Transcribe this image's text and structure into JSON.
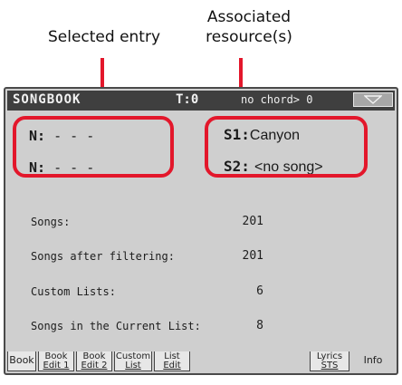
{
  "callouts": {
    "selected": "Selected entry",
    "associated_line1": "Associated",
    "associated_line2": "resource(s)"
  },
  "screen": {
    "title": "SONGBOOK",
    "tempo": "T:0",
    "chord": "no chord> 0",
    "menu_icon": "down-triangle-icon"
  },
  "entry": {
    "n1_key": "N:",
    "n1_value": "- - -",
    "n2_key": "N:",
    "n2_value": "- - -"
  },
  "resources": {
    "s1_key": "S1:",
    "s1_value": "Canyon",
    "s2_key": "S2:",
    "s2_value": "<no song>"
  },
  "info": [
    {
      "label": "Songs:",
      "value": "201"
    },
    {
      "label": "Songs after filtering:",
      "value": "201"
    },
    {
      "label": "Custom Lists:",
      "value": "6"
    },
    {
      "label": "Songs in the Current List:",
      "value": "8"
    }
  ],
  "tabs": [
    {
      "line1": "Book",
      "line2": ""
    },
    {
      "line1": "Book",
      "line2": "Edit 1"
    },
    {
      "line1": "Book",
      "line2": "Edit 2"
    },
    {
      "line1": "Custom",
      "line2": "List"
    },
    {
      "line1": "List",
      "line2": "Edit"
    },
    {
      "line1": "Lyrics",
      "line2": "STS"
    },
    {
      "line1": "Info",
      "line2": ""
    }
  ],
  "colors": {
    "highlight": "#e3172b",
    "screen_bg": "#cfcfcf",
    "titlebar_bg": "#3f3f3f"
  }
}
